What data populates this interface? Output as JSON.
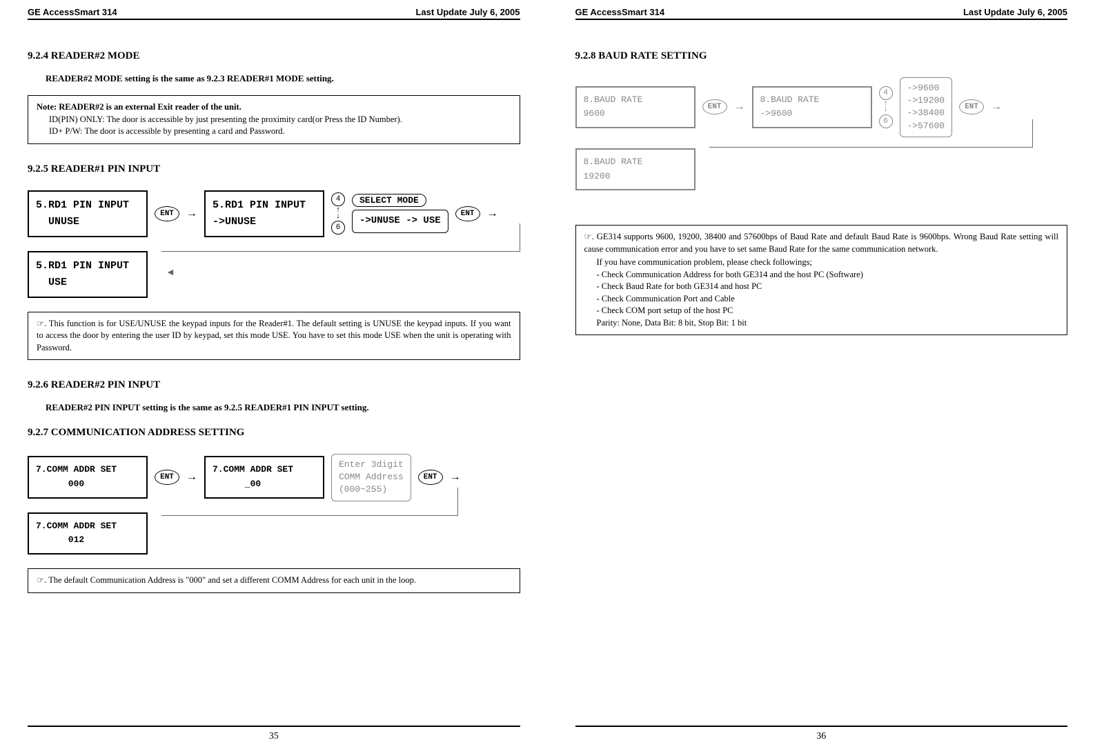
{
  "doc": {
    "product": "GE AccessSmart 314",
    "update": "Last Update July 6, 2005"
  },
  "left": {
    "s924": {
      "heading": "9.2.4 READER#2 MODE",
      "sub": "READER#2 MODE setting is the same as 9.2.3 READER#1 MODE setting.",
      "note_title": "Note: READER#2 is an external Exit reader of the unit.",
      "note_l1": "ID(PIN) ONLY: The door is accessible by just presenting the proximity card(or Press the ID Number).",
      "note_l2": "ID+ P/W: The door is accessible by presenting a card and Password."
    },
    "s925": {
      "heading": "9.2.5 READER#1 PIN INPUT",
      "lcd1_l1": "5.RD1 PIN INPUT",
      "lcd1_l2": "  UNUSE",
      "lcd2_l1": "5.RD1 PIN INPUT",
      "lcd2_l2": "->UNUSE",
      "select_mode": "SELECT MODE",
      "opt1": "->UNUSE",
      "opt2": "-> USE",
      "lcd3_l1": "5.RD1 PIN INPUT",
      "lcd3_l2": "  USE",
      "tip": "☞. This function is for USE/UNUSE the keypad inputs for the Reader#1. The default setting is UNUSE the keypad inputs. If you want to access the door by entering the user ID by keypad, set this mode USE. You have to set this mode USE when the unit is operating with Password."
    },
    "s926": {
      "heading": "9.2.6 READER#2 PIN INPUT",
      "sub": "READER#2 PIN INPUT setting is the same as 9.2.5 READER#1 PIN INPUT setting."
    },
    "s927": {
      "heading": "9.2.7 COMMUNICATION ADDRESS SETTING",
      "lcd1_l1": "7.COMM ADDR SET",
      "lcd1_l2": "      000",
      "lcd2_l1": "7.COMM ADDR SET",
      "lcd2_l2": "      _00",
      "hint_l1": "Enter 3digit",
      "hint_l2": "COMM Address",
      "hint_l3": "(000~255)",
      "lcd3_l1": "7.COMM ADDR SET",
      "lcd3_l2": "      012",
      "tip": "☞. The default Communication Address is \"000\" and set a different COMM Address for each unit in the loop."
    },
    "pagenum": "35"
  },
  "right": {
    "s928": {
      "heading": "9.2.8 BAUD RATE SETTING",
      "lcd1_l1": "8.BAUD RATE",
      "lcd1_l2": "9600",
      "lcd2_l1": "8.BAUD RATE",
      "lcd2_l2": "->9600",
      "opt1": "->9600",
      "opt2": "->19200",
      "opt3": "->38400",
      "opt4": "->57600",
      "lcd3_l1": "8.BAUD RATE",
      "lcd3_l2": "19200",
      "tip_intro": "☞. GE314 supports 9600, 19200, 38400 and 57600bps of Baud Rate and default Baud Rate is 9600bps. Wrong Baud Rate setting will cause communication error and you have to set same Baud Rate for the same communication network.",
      "tip_l0": "If you have communication problem, please check followings;",
      "tip_l1": "- Check Communication Address for both GE314 and the host PC (Software)",
      "tip_l2": "- Check Baud Rate for both GE314 and host PC",
      "tip_l3": "- Check Communication Port and Cable",
      "tip_l4": "- Check COM port setup of the host PC",
      "tip_l5": "   Parity: None, Data Bit: 8 bit, Stop Bit: 1 bit"
    },
    "pagenum": "36"
  },
  "ui": {
    "ent": "ENT",
    "key4": "4",
    "key6": "6"
  }
}
